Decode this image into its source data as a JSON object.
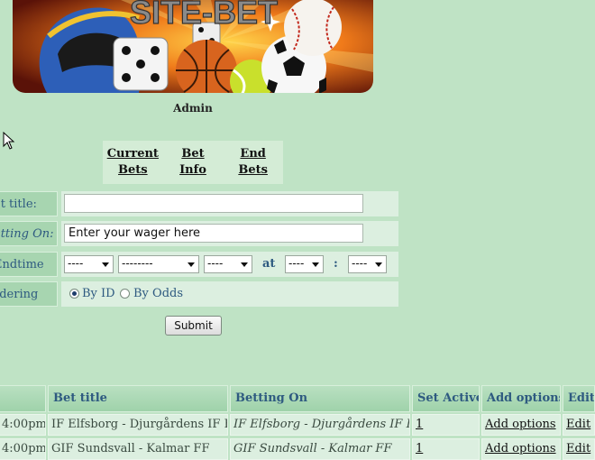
{
  "banner": {
    "logo_text": "SITE-BET"
  },
  "admin_label": "Admin",
  "nav": [
    {
      "label": "Current\nBets"
    },
    {
      "label": "Bet\nInfo"
    },
    {
      "label": "End\nBets"
    }
  ],
  "form": {
    "bet_title": {
      "label": "et title:",
      "value": ""
    },
    "betting_on": {
      "label": "etting On:",
      "value": "Enter your wager here"
    },
    "endtime": {
      "label": "Endtime",
      "day": "----",
      "month": "--------",
      "year": "----",
      "at_label": "at",
      "hour": "----",
      "colon": ":",
      "minute": "----"
    },
    "ordering": {
      "label": "rdering",
      "options": [
        {
          "label": "By ID",
          "selected": true
        },
        {
          "label": "By Odds",
          "selected": false
        }
      ]
    },
    "submit_label": "Submit"
  },
  "table": {
    "headers": [
      "",
      "Bet title",
      "Betting On",
      "Set Active",
      "Add options",
      "Edit"
    ],
    "rows": [
      [
        "4:00pm",
        "IF Elfsborg - Djurgårdens IF FF",
        "IF Elfsborg - Djurgårdens IF FF",
        "1",
        "Add options",
        "Edit"
      ],
      [
        "4:00pm",
        "GIF Sundsvall - Kalmar FF",
        "GIF Sundsvall - Kalmar FF",
        "1",
        "Add options",
        "Edit"
      ]
    ]
  },
  "colors": {
    "background": "#bfe3c5",
    "header_text": "#2e5a80",
    "cell_bg": "#dcefe0"
  }
}
